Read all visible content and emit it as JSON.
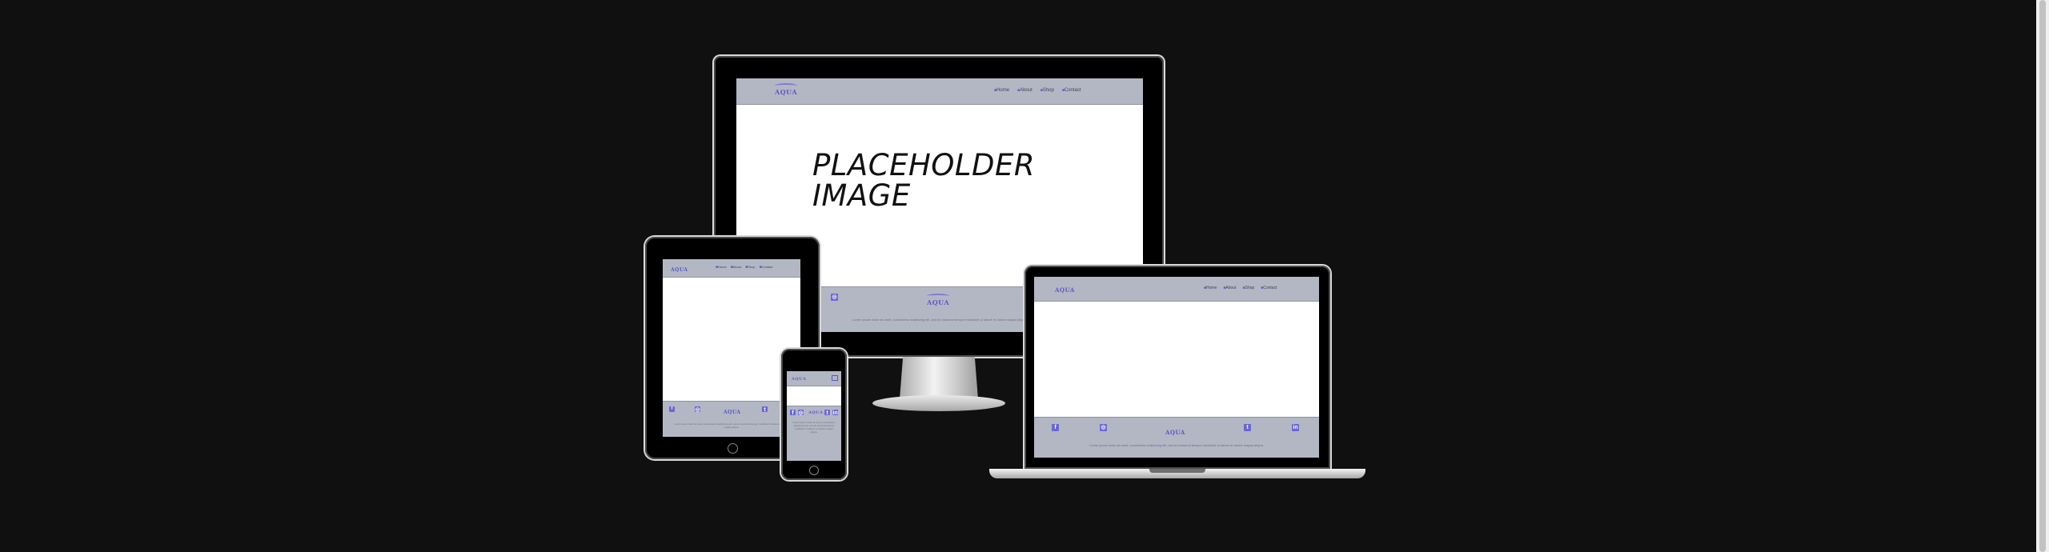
{
  "site": {
    "logo_text": "AQUA",
    "nav": [
      "Home",
      "About",
      "Shop",
      "Contact"
    ],
    "hero_placeholder": "PLACEHOLDER IMAGE",
    "placeholder_line1": "PLACEHOLDER",
    "placeholder_line2": "IMAGE",
    "footer_copy": "Lorem ipsum dolor sit amet, consectetur adipiscing elit, sed do eiusmod tempor incididunt ut labore et dolore magna aliqua.",
    "social_icons": [
      "facebook-icon",
      "instagram-icon",
      "twitter-icon",
      "linkedin-icon"
    ],
    "social_glyphs": [
      "f",
      "◎",
      "t",
      "in"
    ]
  },
  "colors": {
    "background": "#111011",
    "header": "#b3b7c4",
    "brand": "#5b57c9"
  },
  "devices": [
    "monitor",
    "tablet",
    "phone",
    "laptop"
  ]
}
